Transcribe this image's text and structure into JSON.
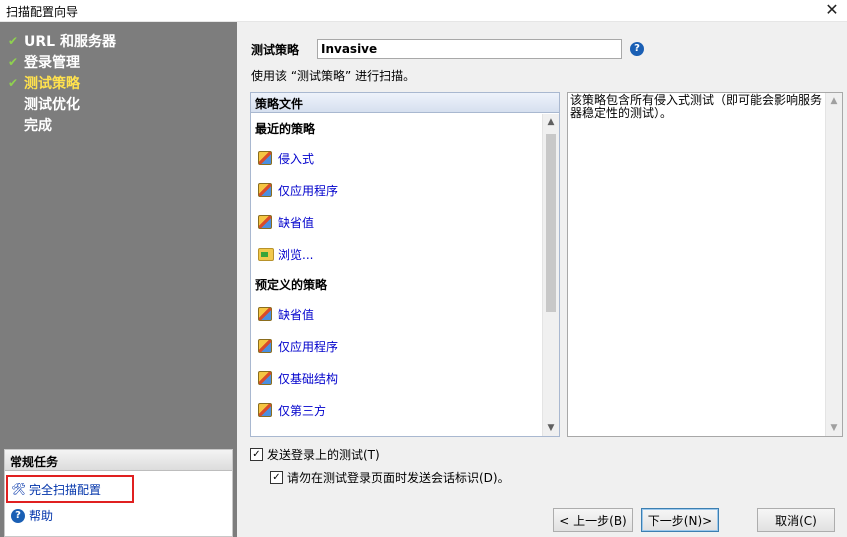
{
  "window": {
    "title": "扫描配置向导",
    "close_glyph": "✕"
  },
  "steps": [
    {
      "label": "URL 和服务器",
      "state": "done"
    },
    {
      "label": "登录管理",
      "state": "done"
    },
    {
      "label": "测试策略",
      "state": "current"
    },
    {
      "label": "测试优化",
      "state": "pending"
    },
    {
      "label": "完成",
      "state": "pending"
    }
  ],
  "tasks": {
    "header": "常规任务",
    "full_config": "完全扫描配置",
    "help": "帮助"
  },
  "policy": {
    "label": "测试策略",
    "value": "Invasive",
    "description": "使用该 “测试策略” 进行扫描。"
  },
  "policy_files": {
    "header": "策略文件",
    "recent_title": "最近的策略",
    "recent": [
      "侵入式",
      "仅应用程序",
      "缺省值",
      "浏览..."
    ],
    "predefined_title": "预定义的策略",
    "predefined": [
      "缺省值",
      "仅应用程序",
      "仅基础结构",
      "仅第三方"
    ]
  },
  "info_text": "该策略包含所有侵入式测试（即可能会影响服务器稳定性的测试）。",
  "options": {
    "send_login_tests": "发送登录上的测试(T)",
    "no_session_ids": "请勿在测试登录页面时发送会话标识(D)。"
  },
  "buttons": {
    "back": "< 上一步(B)",
    "next": "下一步(N)>",
    "cancel": "取消(C)"
  },
  "colors": {
    "accent_current_step": "#ffe14d",
    "link": "#0000cc",
    "highlight_box": "#e02020"
  }
}
